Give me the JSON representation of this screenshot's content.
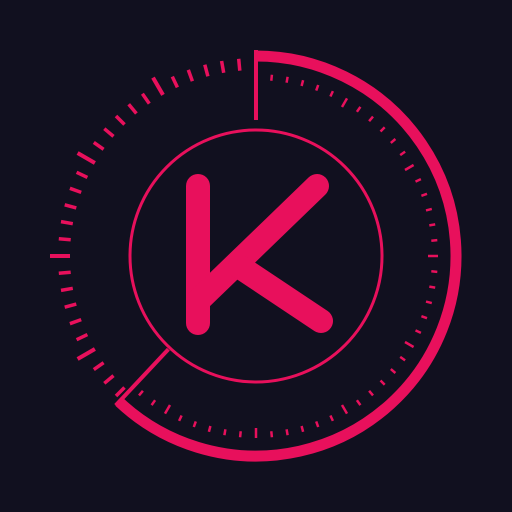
{
  "app_icon": {
    "name": "k-stopwatch-icon",
    "letter": "K",
    "colors": {
      "background": "#11101f",
      "accent": "#e8105c"
    },
    "dial_progress": 0.62
  }
}
